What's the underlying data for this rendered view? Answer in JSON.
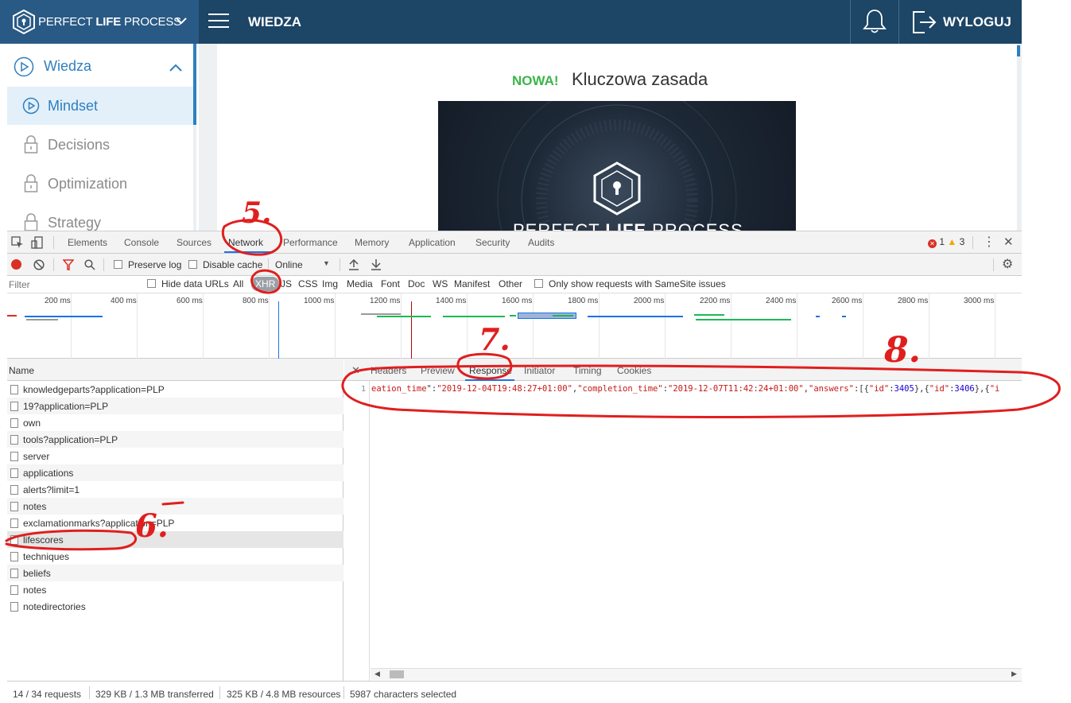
{
  "app": {
    "brand_prefix": "PERFECT ",
    "brand_bold": "LIFE",
    "brand_suffix": " PROCESS",
    "section_title": "WIEDZA",
    "logout_label": "WYLOGUJ"
  },
  "sidebar": {
    "items": [
      {
        "label": "Wiedza",
        "icon": "play-circle-icon"
      },
      {
        "label": "Mindset",
        "icon": "play-circle-icon"
      },
      {
        "label": "Decisions",
        "icon": "lock-icon"
      },
      {
        "label": "Optimization",
        "icon": "lock-icon"
      },
      {
        "label": "Strategy",
        "icon": "lock-icon"
      }
    ]
  },
  "main": {
    "badge": "NOWA!",
    "title": "Kluczowa zasada",
    "hero_brand_prefix": "PERFECT ",
    "hero_brand_bold": "LIFE",
    "hero_brand_suffix": " PROCESS"
  },
  "devtools": {
    "tabs": [
      "Elements",
      "Console",
      "Sources",
      "Network",
      "Performance",
      "Memory",
      "Application",
      "Security",
      "Audits"
    ],
    "errors": "1",
    "warnings": "3",
    "toolbar": {
      "preserve_log": "Preserve log",
      "disable_cache": "Disable cache",
      "throttle": "Online"
    },
    "filter": {
      "placeholder": "Filter",
      "hide_data_urls": "Hide data URLs",
      "types": [
        "All",
        "XHR",
        "JS",
        "CSS",
        "Img",
        "Media",
        "Font",
        "Doc",
        "WS",
        "Manifest",
        "Other"
      ],
      "same_site": "Only show requests with SameSite issues"
    },
    "timeline_ticks": [
      "200 ms",
      "400 ms",
      "600 ms",
      "800 ms",
      "1000 ms",
      "1200 ms",
      "1400 ms",
      "1600 ms",
      "1800 ms",
      "2000 ms",
      "2200 ms",
      "2400 ms",
      "2600 ms",
      "2800 ms",
      "3000 ms"
    ],
    "name_header": "Name",
    "requests": [
      "knowledgeparts?application=PLP",
      "19?application=PLP",
      "own",
      "tools?application=PLP",
      "server",
      "applications",
      "alerts?limit=1",
      "notes",
      "exclamationmarks?application=PLP",
      "lifescores",
      "techniques",
      "beliefs",
      "notes",
      "notedirectories"
    ],
    "detail_tabs": [
      "Headers",
      "Preview",
      "Response",
      "Initiator",
      "Timing",
      "Cookies"
    ],
    "response_line_number": "1",
    "response": {
      "k1": "eation_time",
      "v1": "\"2019-12-04T19:48:27+01:00\"",
      "k2": "\"completion_time\"",
      "v2": "\"2019-12-07T11:42:24+01:00\"",
      "k3": "\"answers\"",
      "k4": "\"id\"",
      "n1": "3405",
      "k5": "\"id\"",
      "n2": "3406",
      "tail": "\"i"
    },
    "status": {
      "requests": "14 / 34 requests",
      "transferred": "329 KB / 1.3 MB transferred",
      "resources": "325 KB / 4.8 MB resources",
      "selection": "5987 characters selected"
    }
  },
  "annotations": [
    "5.",
    "6.",
    "7.",
    "8."
  ]
}
